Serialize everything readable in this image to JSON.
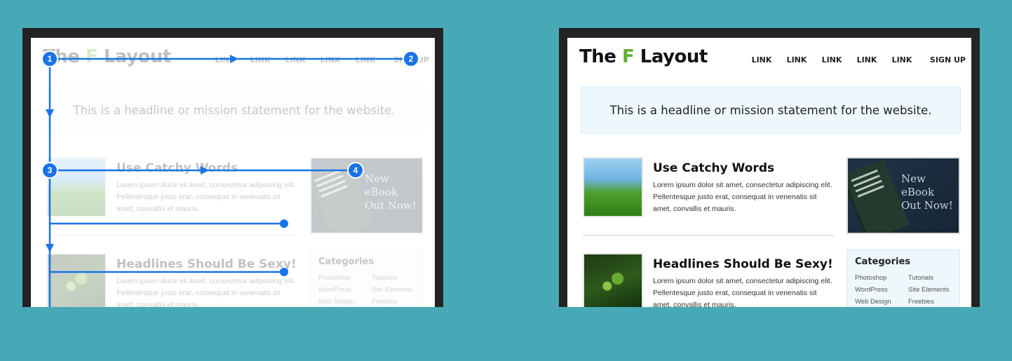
{
  "site": {
    "logo": {
      "part1": "The ",
      "accent": "F",
      "part2": " Layout",
      "accent_color": "#5fb12c"
    },
    "nav": [
      "LINK",
      "LINK",
      "LINK",
      "LINK",
      "LINK",
      "SIGN UP"
    ],
    "headline": "This is a headline or mission statement for the website.",
    "articles": [
      {
        "title": "Use Catchy Words",
        "body": "Lorem ipsum dolor sit amet, consectetur adipiscing elit. Pellentesque justo erat, consequat in venenatis sit amet, convallis et mauris.",
        "thumb_icon": "sky-grass-image"
      },
      {
        "title": "Headlines Should Be Sexy!",
        "body": "Lorem ipsum dolor sit amet, consectetur adipiscing elit. Pellentesque justo erat, consequat in venenatis sit amet, convallis et mauris.",
        "thumb_icon": "leaf-sprout-image"
      }
    ],
    "promo": {
      "line1": "New",
      "line2": "eBook",
      "line3": "Out Now!"
    },
    "categories": {
      "title": "Categories",
      "items": [
        "Photoshop",
        "Tutorials",
        "WordPress",
        "Site Elements",
        "Web Design",
        "Freebies"
      ]
    }
  },
  "overlay": {
    "markers": [
      "1",
      "2",
      "3",
      "4"
    ],
    "line_color": "#1a73e8"
  },
  "colors": {
    "background": "#48a9b6",
    "device_frame": "#232323"
  }
}
